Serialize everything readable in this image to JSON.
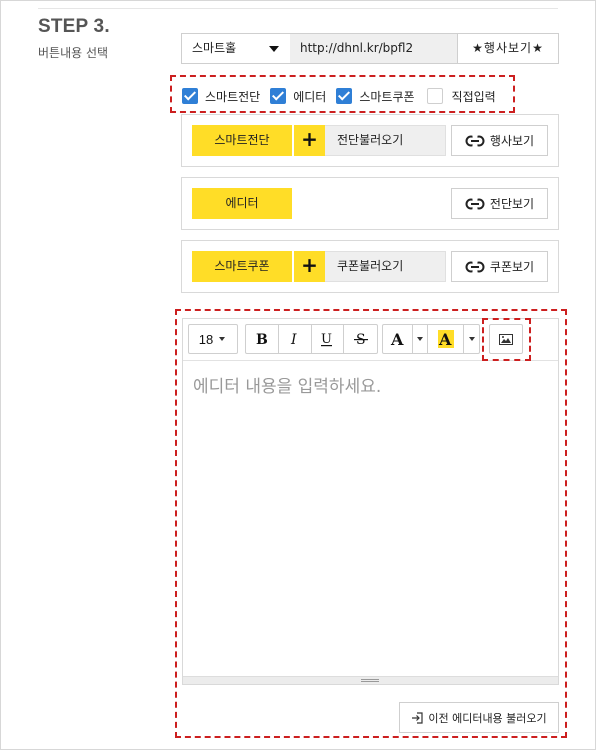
{
  "step": {
    "title": "STEP 3.",
    "subtitle": "버튼내용 선택"
  },
  "source": {
    "selected": "스마트홀",
    "url": "http://dhnl.kr/bpfl2",
    "event_button": "★행사보기★"
  },
  "options": [
    {
      "label": "스마트전단",
      "checked": true
    },
    {
      "label": "에디터",
      "checked": true
    },
    {
      "label": "스마트쿠폰",
      "checked": true
    },
    {
      "label": "직접입력",
      "checked": false
    }
  ],
  "panels": {
    "smart_flyer": {
      "button": "스마트전단",
      "plus": "+",
      "load": "전단불러오기",
      "view": "행사보기"
    },
    "editor": {
      "button": "에디터",
      "view": "전단보기"
    },
    "smart_coupon": {
      "button": "스마트쿠폰",
      "plus": "+",
      "load": "쿠폰불러오기",
      "view": "쿠폰보기"
    }
  },
  "editor": {
    "font_size": "18",
    "placeholder": "에디터 내용을 입력하세요.",
    "prev_button": "이전 에디터내용 불러오기"
  },
  "icons": {
    "select_caret": "chevron-down-icon",
    "link": "link-icon",
    "image": "image-icon",
    "import": "import-icon"
  },
  "colors": {
    "accent_yellow": "#ffdd27",
    "checkbox_blue": "#2f7fd6",
    "highlight_dashed": "#cc1f1f"
  }
}
